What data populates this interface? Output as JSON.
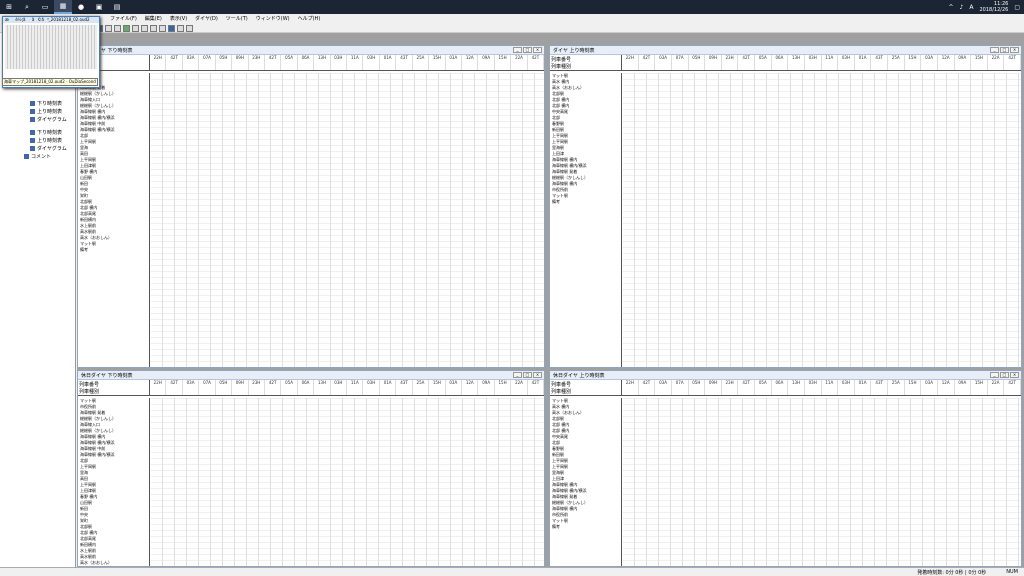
{
  "taskbar": {
    "clock_time": "11:26",
    "clock_date": "2018/12/26",
    "ime": "A"
  },
  "thumbnail": {
    "title": "æè½¦ãã©ã³_20181218_02.oud2",
    "tooltip": "海車マップ_20181218_02.oud2 - OuDiaSecond"
  },
  "menu": [
    "ファイル(F)",
    "編集(E)",
    "表示(V)",
    "ダイヤ(D)",
    "ツール(T)",
    "ウィンドウ(W)",
    "ヘルプ(H)"
  ],
  "tree": [
    "下り時刻表",
    "上り時刻表",
    "ダイヤグラム",
    "下り時刻表",
    "上り時刻表",
    "ダイヤグラム",
    "コメント"
  ],
  "windows": {
    "w1": {
      "title": "平日ダイヤ 下り時刻表",
      "hdr1": "列車番号",
      "hdr2": "列車種別"
    },
    "w2": {
      "title": "ダイヤ 上り時刻表",
      "hdr1": "列車番号",
      "hdr2": "列車種別"
    },
    "w3": {
      "title": "休日ダイヤ 下り時刻表",
      "hdr1": "列車番号",
      "hdr2": "列車種別"
    },
    "w4": {
      "title": "休日ダイヤ 上り時刻表",
      "hdr1": "列車番号",
      "hdr2": "列車種別"
    }
  },
  "columns_top": [
    "22H",
    "42T",
    "03A",
    "07A",
    "05H",
    "09H",
    "23H",
    "42T",
    "05A",
    "06A",
    "13H",
    "03H",
    "11A",
    "03H",
    "01A",
    "43T",
    "25A",
    "15H",
    "03A",
    "12A",
    "09A",
    "15H",
    "22A",
    "42T"
  ],
  "stations_w1": [
    "マット駅",
    "市役所前",
    "海車線駅 発着",
    "総総駅（かしんし）",
    "海車線入口",
    "総総駅（かしんし）",
    "海車線駅 横内",
    "海車線駅 横内/横浜",
    "海車線駅 中前",
    "海車線駅 横内/横浜",
    "北部",
    "上平岡駅",
    "里海",
    "高田",
    "上平岡駅",
    "上田津駅",
    "春野 横内",
    "山田駅",
    "新田",
    "中央",
    "栄町",
    "北部駅",
    "北部 横内",
    "北部高尾",
    "新田横内",
    "水上駅前",
    "高水駅前",
    "高水（おおしん）",
    "マット駅",
    "備考"
  ],
  "stations_w2": [
    "マット駅",
    "高水 横内",
    "高水（おおしん）",
    "北部駅",
    "北部 横内",
    "北部 横内",
    "中央高尾",
    "北部",
    "春野駅",
    "新田駅",
    "上平岡駅",
    "上平岡駅",
    "里海駅",
    "上田津",
    "海車線駅 横内",
    "海車線駅 横内/横浜",
    "海車線駅 発着",
    "総総駅（かしんし）",
    "海車線駅 横内",
    "市役所前",
    "マット駅",
    "備考"
  ],
  "status": {
    "count": "発着時刻数: 0分 0秒 | 0分 0秒",
    "mode": "NUM"
  }
}
